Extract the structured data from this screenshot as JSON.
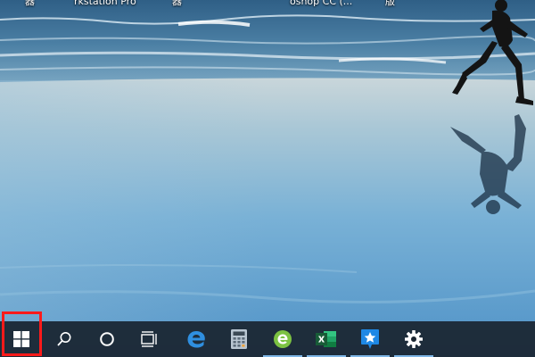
{
  "desktop": {
    "wallpaper": "beach-runner-wallpaper",
    "icon_labels": [
      {
        "id": "label1",
        "text": "器"
      },
      {
        "id": "label2",
        "text": "rkstation Pro"
      },
      {
        "id": "label3",
        "text": "器"
      },
      {
        "id": "label4",
        "text": "oshop CC (..."
      },
      {
        "id": "label5",
        "text": "版"
      }
    ]
  },
  "taskbar": {
    "background": "#1a2530",
    "active_indicator_color": "#7fb6e6",
    "buttons": [
      {
        "id": "start",
        "icon": "windows-logo-icon"
      },
      {
        "id": "search",
        "icon": "search-icon"
      },
      {
        "id": "cortana",
        "icon": "cortana-circle-icon"
      },
      {
        "id": "task_view",
        "icon": "task-view-icon"
      },
      {
        "id": "edge",
        "icon": "edge-browser-icon"
      },
      {
        "id": "calculator",
        "icon": "calculator-icon"
      },
      {
        "id": "browser360",
        "icon": "green-e-browser-icon"
      },
      {
        "id": "excel",
        "icon": "excel-icon"
      },
      {
        "id": "app_star",
        "icon": "blue-star-app-icon"
      },
      {
        "id": "settings",
        "icon": "gear-icon"
      }
    ]
  },
  "annotation": {
    "highlight_color": "#ff1a1a",
    "highlight_target": "start"
  }
}
